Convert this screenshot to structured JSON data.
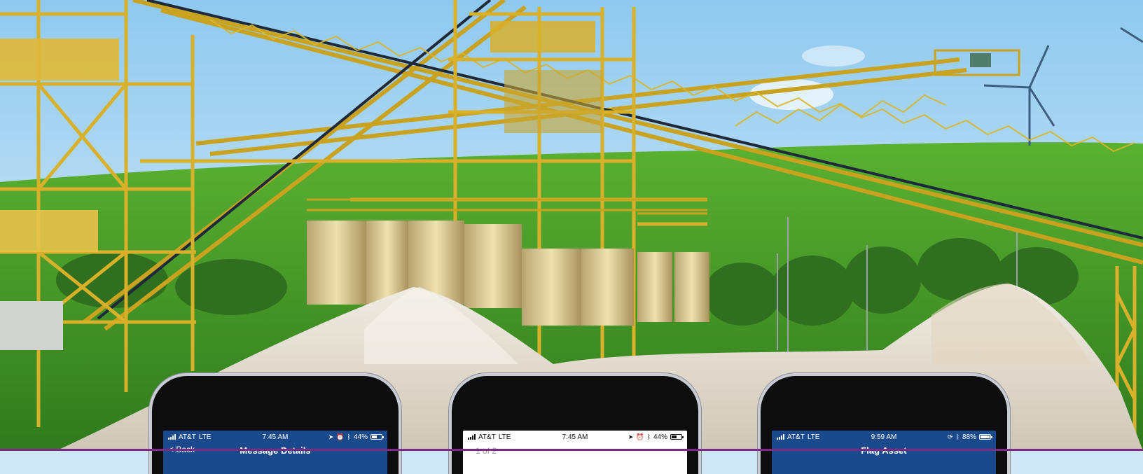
{
  "scene": {
    "description_colors": {
      "sky": "#cfe6f5",
      "hill": "#4e9e2a",
      "steel": "#d9b62a",
      "sand": "#e8e3d6"
    }
  },
  "phones": [
    {
      "carrier": "AT&T",
      "network": "LTE",
      "time": "7:45 AM",
      "battery": "44%",
      "battery_level": 0.44,
      "status_icons": [
        "location-icon",
        "alarm-icon",
        "bluetooth-icon"
      ],
      "title": "Message Details",
      "back_label": "< Back",
      "theme": "#1a4a8c"
    },
    {
      "carrier": "AT&T",
      "network": "LTE",
      "time": "7:45 AM",
      "battery": "44%",
      "battery_level": 0.44,
      "status_icons": [
        "location-icon",
        "alarm-icon",
        "bluetooth-icon"
      ],
      "pager": "1 of 2",
      "theme": "#ffffff"
    },
    {
      "carrier": "AT&T",
      "network": "LTE",
      "time": "9:59 AM",
      "battery": "88%",
      "battery_level": 0.88,
      "status_icons": [
        "rotation-lock-icon",
        "bluetooth-icon"
      ],
      "title": "Flag Asset",
      "theme": "#1a4a8c"
    }
  ]
}
